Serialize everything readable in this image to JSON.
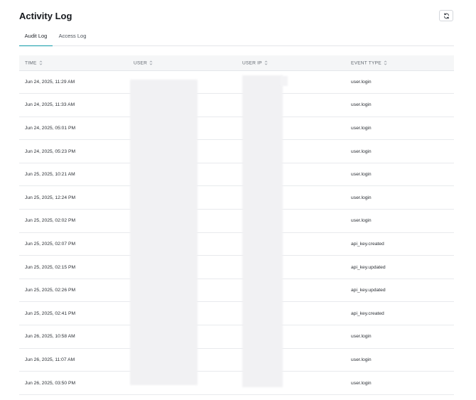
{
  "header": {
    "title": "Activity Log",
    "refresh_icon": "refresh-icon"
  },
  "tabs": [
    {
      "label": "Audit Log",
      "active": true
    },
    {
      "label": "Access Log",
      "active": false
    }
  ],
  "table": {
    "columns": [
      {
        "label": "TIME",
        "sort_icon": "sort-icon"
      },
      {
        "label": "USER",
        "sort_icon": "sort-icon"
      },
      {
        "label": "USER IP",
        "sort_icon": "sort-icon"
      },
      {
        "label": "EVENT TYPE",
        "sort_icon": "sort-icon"
      }
    ],
    "rows": [
      {
        "time": "Jun 24, 2025, 11:29 AM",
        "user": "",
        "user_ip": "",
        "event_type": "user.login"
      },
      {
        "time": "Jun 24, 2025, 11:33 AM",
        "user": "",
        "user_ip": "",
        "event_type": "user.login"
      },
      {
        "time": "Jun 24, 2025, 05:01 PM",
        "user": "",
        "user_ip": "",
        "event_type": "user.login"
      },
      {
        "time": "Jun 24, 2025, 05:23 PM",
        "user": "",
        "user_ip": "",
        "event_type": "user.login"
      },
      {
        "time": "Jun 25, 2025, 10:21 AM",
        "user": "",
        "user_ip": "",
        "event_type": "user.login"
      },
      {
        "time": "Jun 25, 2025, 12:24 PM",
        "user": "",
        "user_ip": "",
        "event_type": "user.login"
      },
      {
        "time": "Jun 25, 2025, 02:02 PM",
        "user": "",
        "user_ip": "",
        "event_type": "user.login"
      },
      {
        "time": "Jun 25, 2025, 02:07 PM",
        "user": "",
        "user_ip": "",
        "event_type": "api_key.created"
      },
      {
        "time": "Jun 25, 2025, 02:15 PM",
        "user": "",
        "user_ip": "",
        "event_type": "api_key.updated"
      },
      {
        "time": "Jun 25, 2025, 02:26 PM",
        "user": "",
        "user_ip": "",
        "event_type": "api_key.updated"
      },
      {
        "time": "Jun 25, 2025, 02:41 PM",
        "user": "",
        "user_ip": "",
        "event_type": "api_key.created"
      },
      {
        "time": "Jun 26, 2025, 10:58 AM",
        "user": "",
        "user_ip": "",
        "event_type": "user.login"
      },
      {
        "time": "Jun 26, 2025, 11:07 AM",
        "user": "",
        "user_ip": "",
        "event_type": "user.login"
      },
      {
        "time": "Jun 26, 2025, 03:50 PM",
        "user": "",
        "user_ip": "",
        "event_type": "user.login"
      }
    ]
  },
  "colors": {
    "accent": "#0f9aa8",
    "header_bg": "#f5f6f7",
    "border": "#e4e6ea",
    "redaction": "#f1f1f3"
  }
}
